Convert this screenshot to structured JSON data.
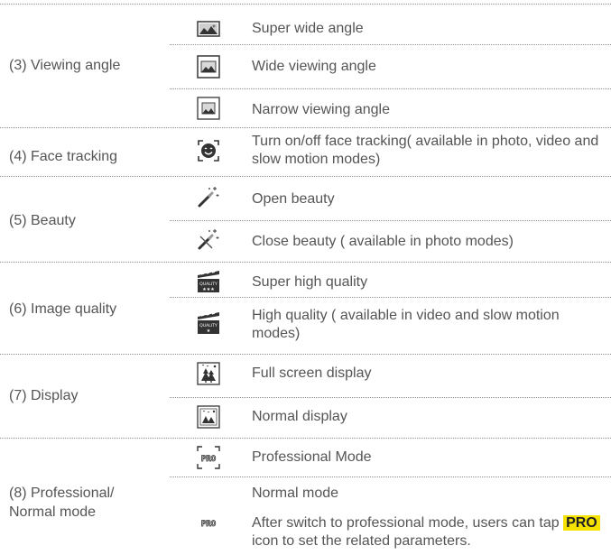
{
  "rows": [
    {
      "category": "(3) Viewing angle",
      "items": [
        {
          "icon": "super-wide-angle-icon",
          "text": "Super wide angle"
        },
        {
          "icon": "wide-angle-icon",
          "text": "Wide viewing angle"
        },
        {
          "icon": "narrow-angle-icon",
          "text": "Narrow viewing angle"
        }
      ]
    },
    {
      "category": "(4) Face tracking",
      "items": [
        {
          "icon": "face-tracking-icon",
          "text": "Turn on/off face tracking( available in photo, video and slow motion modes)"
        }
      ]
    },
    {
      "category": "(5) Beauty",
      "items": [
        {
          "icon": "beauty-wand-icon",
          "text": "Open beauty"
        },
        {
          "icon": "beauty-off-icon",
          "text": "Close beauty ( available in photo modes)"
        }
      ]
    },
    {
      "category": "(6) Image quality",
      "items": [
        {
          "icon": "super-high-quality-icon",
          "icon_label": "QUALITY",
          "text": "Super high quality"
        },
        {
          "icon": "high-quality-icon",
          "icon_label": "QUALITY",
          "text": "High quality ( available in video and slow motion modes)"
        }
      ]
    },
    {
      "category": "(7) Display",
      "items": [
        {
          "icon": "full-screen-display-icon",
          "text": "Full screen display"
        },
        {
          "icon": "normal-display-icon",
          "text": "Normal display"
        }
      ]
    },
    {
      "category": "(8) Professional/ Normal mode",
      "items": [
        {
          "icon": "pro-mode-icon",
          "icon_label": "PRO",
          "text": "Professional Mode"
        },
        {
          "icon": "normal-mode-icon",
          "icon_label": "PRO",
          "text": "Normal mode",
          "note_before": "After switch to professional mode, users can tap",
          "note_chip": "PRO",
          "note_after": "icon to set the related parameters."
        }
      ]
    }
  ],
  "colors": {
    "text": "#555555",
    "separator": "#8c8c8c",
    "pro_highlight": "#f5e200",
    "icon": "#333333"
  }
}
